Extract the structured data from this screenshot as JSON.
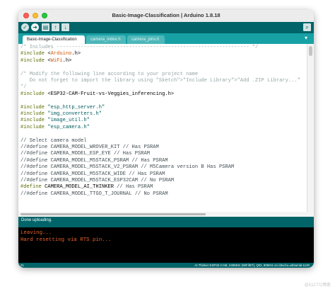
{
  "window": {
    "title": "Basic-Image-Classification | Arduino 1.8.18"
  },
  "toolbar": {
    "verify": "✓",
    "upload": "➜",
    "new": "▤",
    "open": "↑",
    "save": "↓",
    "serial": "⌕"
  },
  "tabs": [
    "Basic-Image-Classification",
    "camera_index.h",
    "camera_pins.h"
  ],
  "tab_menu": "▾",
  "code": [
    "/* Includes ---------------------------------------------------------------- */",
    "#include <Arduino.h>",
    "#include <WiFi.h>",
    "",
    "/* Modify the following line according to your project name",
    "   Do not forget to import the library using \"Sketch\">\"Include Library\">\"Add .ZIP Library...\"",
    "*/",
    "#include <ESP32-CAM-Fruit-vs-Veggies_inferencing.h>",
    "",
    "#include \"esp_http_server.h\"",
    "#include \"img_converters.h\"",
    "#include \"image_util.h\"",
    "#include \"esp_camera.h\"",
    "",
    "// Select camera model",
    "//#define CAMERA_MODEL_WROVER_KIT // Has PSRAM",
    "//#define CAMERA_MODEL_ESP_EYE // Has PSRAM",
    "//#define CAMERA_MODEL_M5STACK_PSRAM // Has PSRAM",
    "//#define CAMERA_MODEL_M5STACK_V2_PSRAM // M5Camera version B Has PSRAM",
    "//#define CAMERA_MODEL_M5STACK_WIDE // Has PSRAM",
    "//#define CAMERA_MODEL_M5STACK_ESP32CAM // No PSRAM",
    "#define CAMERA_MODEL_AI_THINKER // Has PSRAM",
    "//#define CAMERA_MODEL_TTGO_T_JOURNAL // No PSRAM"
  ],
  "status": "Done uploading.",
  "console": [
    "Leaving...",
    "Hard resetting via RTS pin..."
  ],
  "bottom": {
    "line": "21",
    "board": "AI Thinker ESP32-CAM, 240MHz (WiFi/BT), QIO, 80MHz on /dev/cu.usbserial-1120"
  },
  "watermark": "@51CTO博客",
  "colors": {
    "toolbar": "#006468",
    "tabbar": "#17a1a5",
    "console_text": "#e8622d",
    "keyword": "#5e6d03",
    "type": "#00979c",
    "comment": "#95a5a6",
    "string": "#005c5f"
  }
}
